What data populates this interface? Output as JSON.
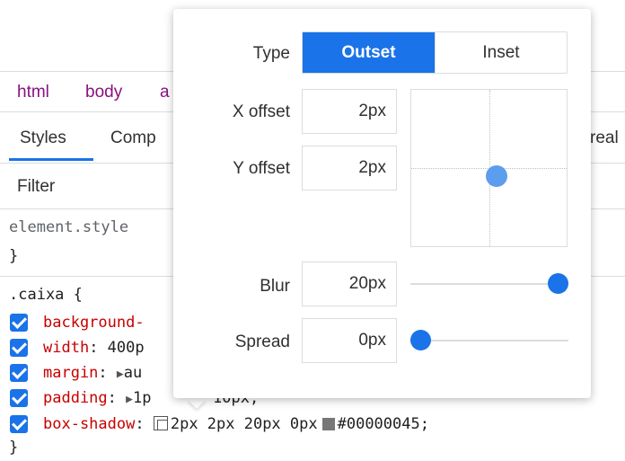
{
  "breadcrumb": [
    "html",
    "body",
    "a"
  ],
  "tabs": {
    "styles": "Styles",
    "computed": "Comp",
    "overflow": "real"
  },
  "filter": {
    "label": "Filter"
  },
  "rules": {
    "element_style_selector": "element.style",
    "element_style_close": "}",
    "caixa_selector": ".caixa {",
    "caixa_close": "}",
    "declarations": [
      {
        "prop": "background-",
        "value": "",
        "checked": true
      },
      {
        "prop": "width",
        "value": "400p",
        "checked": true
      },
      {
        "prop": "margin",
        "value": "au",
        "checked": true
      },
      {
        "prop": "padding",
        "value": "1p",
        "checked": true
      },
      {
        "prop": "box-shadow",
        "value": "2px 2px 20px 0px",
        "color": "#00000045;",
        "checked": true
      }
    ],
    "padding_tail": "10px;"
  },
  "shadow_editor": {
    "type_label": "Type",
    "type_options": [
      "Outset",
      "Inset"
    ],
    "type_selected": "Outset",
    "x_offset": {
      "label": "X offset",
      "value": "2px"
    },
    "y_offset": {
      "label": "Y offset",
      "value": "2px"
    },
    "blur": {
      "label": "Blur",
      "value": "20px",
      "slider_fraction": 1.0
    },
    "spread": {
      "label": "Spread",
      "value": "0px",
      "slider_fraction": 0.0
    },
    "accent_color": "#1a73e8"
  }
}
